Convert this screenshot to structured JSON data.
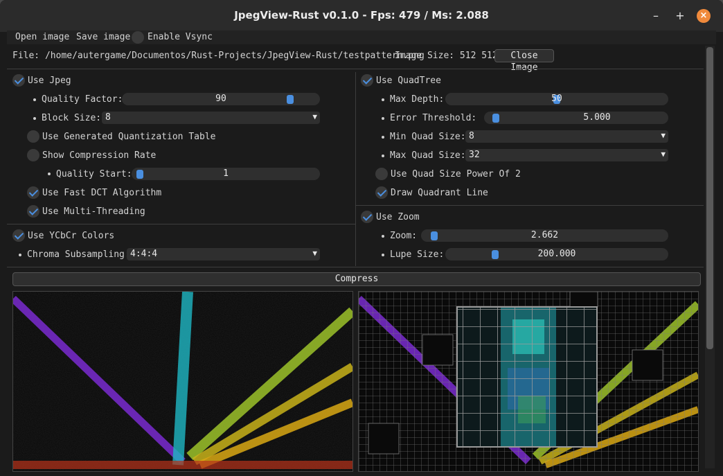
{
  "window": {
    "title": "JpegView-Rust v0.1.0 - Fps: 479 / Ms: 2.088"
  },
  "titlebar": {
    "minimize_glyph": "–",
    "maximize_glyph": "+",
    "close_glyph": "×"
  },
  "menu": {
    "open": "Open image",
    "save": "Save image",
    "vsync": "Enable Vsync"
  },
  "file": {
    "path": "File: /home/autergame/Documentos/Rust-Projects/JpegView-Rust/testpattern.png",
    "size": "Image Size: 512 512",
    "close": "Close Image"
  },
  "jpeg": {
    "use": "Use Jpeg",
    "quality_label": "Quality Factor:",
    "quality_value": "90",
    "quality_fraction": 0.88,
    "block_label": "Block Size:",
    "block_value": "8",
    "gen_quant": "Use Generated Quantization Table",
    "show_rate": "Show Compression Rate",
    "quality_start_label": "Quality Start:",
    "quality_start_value": "1",
    "quality_start_fraction": 0.0,
    "fast_dct": "Use Fast DCT Algorithm",
    "multithread": "Use Multi-Threading"
  },
  "ycbcr": {
    "use": "Use YCbCr Colors",
    "chroma_label": "Chroma Subsampling:",
    "chroma_value": "4:4:4"
  },
  "quadtree": {
    "use": "Use QuadTree",
    "max_depth_label": "Max Depth:",
    "max_depth_value": "50",
    "max_depth_fraction": 0.5,
    "error_label": "Error Threshold:",
    "error_value": "5.000",
    "error_fraction": 0.02,
    "min_label": "Min Quad Size:",
    "min_value": "8",
    "max_label": "Max Quad Size:",
    "max_value": "32",
    "power2": "Use Quad Size Power Of 2",
    "draw_lines": "Draw Quadrant Line"
  },
  "zoom": {
    "use": "Use Zoom",
    "zoom_label": "Zoom:",
    "zoom_value": "2.662",
    "zoom_fraction": 0.02,
    "lupe_label": "Lupe Size:",
    "lupe_value": "200.000",
    "lupe_fraction": 0.2
  },
  "compress": "Compress",
  "colors": {
    "accent": "#4a8fe0",
    "close_btn": "#f08a3c",
    "background": "#1b1b1b"
  }
}
